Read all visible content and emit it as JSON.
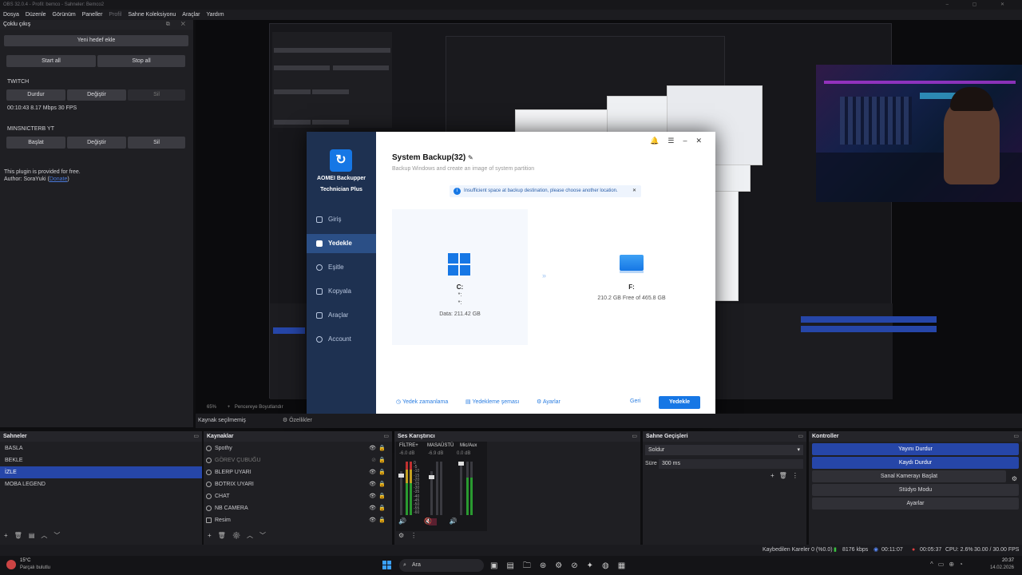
{
  "title_bar": "OBS 32.0.4 - Profil: bemco - Sahneler: Bemco2",
  "menu": [
    "Dosya",
    "Düzenle",
    "Görünüm",
    "Paneller",
    "Profil",
    "Sahne Koleksiyonu",
    "Araçlar",
    "Yardım"
  ],
  "multi_output": {
    "title": "Çoklu çıkış",
    "add_target": "Yeni hedef ekle",
    "start_all": "Start all",
    "stop_all": "Stop all",
    "targets": [
      {
        "name": "TWITCH",
        "primary": "Durdur",
        "edit": "Değiştir",
        "delete": "Sil",
        "stats": "00:10:43  8.17 Mbps  30 FPS"
      },
      {
        "name": "MINSNICTERB YT",
        "primary": "Başlat",
        "edit": "Değiştir",
        "delete": "Sil"
      }
    ],
    "footer_line1": "This plugin is provided for free.",
    "footer_line2_prefix": "Author: SoraYuki (",
    "footer_link": "Donate",
    "footer_line2_suffix": ")"
  },
  "aomei": {
    "brand_line1": "AOMEI Backupper",
    "brand_line2": "Technician Plus",
    "nav": [
      "Giriş",
      "Yedekle",
      "Eşitle",
      "Kopyala",
      "Araçlar",
      "Account"
    ],
    "active_nav": "Yedekle",
    "task_title": "System Backup(32)",
    "subtitle": "Backup Windows and create an image of system partition",
    "warning": "Insufficient space at backup destination, please choose another location.",
    "source": {
      "drive": "C:",
      "line2": "*:",
      "line3": "*:",
      "data": "Data: 211.42 GB"
    },
    "dest": {
      "drive": "F:",
      "free": "210.2 GB Free of 465.8 GB"
    },
    "bottom_links": [
      "Yedek zamanlama",
      "Yedekleme şeması",
      "Ayarlar"
    ],
    "back": "Geri",
    "backup": "Yedekle"
  },
  "preview_bar": {
    "zoom": "65%",
    "fit": "Pencereye Boyutlandır"
  },
  "source_bar": {
    "no_source": "Kaynak seçilmemiş",
    "props": "Özellikler"
  },
  "scenes": {
    "title": "Sahneler",
    "items": [
      "BASLA",
      "BEKLE",
      "İZLE",
      "MOBA LEGEND"
    ],
    "selected": "İZLE"
  },
  "sources": {
    "title": "Kaynaklar",
    "items": [
      "Spothy",
      "GÖREV ÇUBUĞU",
      "BLERP UYARI",
      "BOTRIX UYARI",
      "CHAT",
      "NB CAMERA",
      "Resim"
    ]
  },
  "mixer": {
    "title": "Ses Karıştırıcı",
    "channels": [
      {
        "name": "FİLTRE+",
        "db": "-6.0 dB"
      },
      {
        "name": "MASAÜSTÜ",
        "db": "-6.9 dB"
      },
      {
        "name": "Mic/Aux",
        "db": "0.0 dB"
      }
    ],
    "scale": [
      "0",
      "-5",
      "-10",
      "-15",
      "-20",
      "-25",
      "-30",
      "-35",
      "-40",
      "-45",
      "-50",
      "-55",
      "-60"
    ]
  },
  "transitions": {
    "title": "Sahne Geçişleri",
    "selected": "Soldur",
    "duration_label": "Süre",
    "duration": "300 ms"
  },
  "controls": {
    "title": "Kontroller",
    "buttons": [
      "Yayını Durdur",
      "Kaydı Durdur",
      "Sanal Kamerayı Başlat",
      "Stüdyo Modu",
      "Ayarlar"
    ]
  },
  "status": {
    "dropped": "Kaybedilen Kareler 0 (%0.0)",
    "bitrate": "8176 kbps",
    "live": "00:11:07",
    "rec": "00:05:37",
    "cpu": "CPU: 2.6%",
    "fps": "30.00 / 30.00 FPS"
  },
  "taskbar": {
    "weather_temp": "15°C",
    "weather_desc": "Parçalı bulutlu",
    "search": "Ara",
    "time": "20:37",
    "date": "14.02.2026"
  },
  "colors": {
    "obs_blue": "#2646a8",
    "aomei_sidebar": "#1e3151",
    "aomei_blue": "#1677e5"
  }
}
